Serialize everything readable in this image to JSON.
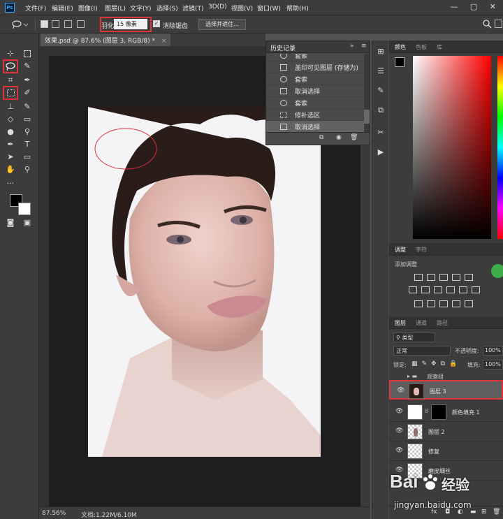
{
  "app": {
    "logo": "Ps"
  },
  "menu": [
    "文件(F)",
    "编辑(E)",
    "图像(I)",
    "图层(L)",
    "文字(Y)",
    "选择(S)",
    "滤镜(T)",
    "3D(D)",
    "视图(V)",
    "窗口(W)",
    "帮助(H)"
  ],
  "window_controls": {
    "minimize": "—",
    "restore": "▢",
    "close": "✕"
  },
  "options": {
    "feather_label": "羽化:",
    "feather_value": "15 像素",
    "antialias_label": "消除锯齿",
    "select_mask_button": "选择并遮住..."
  },
  "document": {
    "tab_title": "效果.psd @ 87.6% (图层 3, RGB/8) *",
    "close": "×"
  },
  "status": {
    "zoom": "87.56%",
    "doc_size": "文档:1.22M/6.10M"
  },
  "history": {
    "title": "历史记录",
    "items": [
      "套索",
      "盖印可见图层 (存储为)",
      "套索",
      "取消选择",
      "套索",
      "修补选区",
      "取消选择"
    ],
    "selected_index": 6
  },
  "color_panel": {
    "tabs": [
      "颜色",
      "色板",
      "库"
    ]
  },
  "adjustments_panel": {
    "tabs": [
      "调整",
      "字符"
    ],
    "heading": "添加调整"
  },
  "layers_panel": {
    "tabs": [
      "图层",
      "通道",
      "路径"
    ],
    "filter_label": "类型",
    "blend_mode": "正常",
    "opacity_label": "不透明度:",
    "opacity_value": "100%",
    "lock_label": "锁定:",
    "fill_label": "填充:",
    "fill_value": "100%",
    "group_name": "观察组",
    "layers": [
      {
        "name": "图层 3",
        "selected": true
      },
      {
        "name": "颜色填充 1",
        "selected": false
      },
      {
        "name": "图层 2",
        "selected": false
      },
      {
        "name": "修复",
        "selected": false
      },
      {
        "name": "磨皮细丝",
        "selected": false
      }
    ]
  },
  "watermark": {
    "brand": "Bai",
    "brand_cn": "经验",
    "url": "jingyan.baidu.com"
  },
  "colors": {
    "accent_red": "#e0323a",
    "ps_blue": "#31a8ff",
    "panel_bg": "#3c3c3c",
    "canvas_bg": "#1e1e20"
  }
}
